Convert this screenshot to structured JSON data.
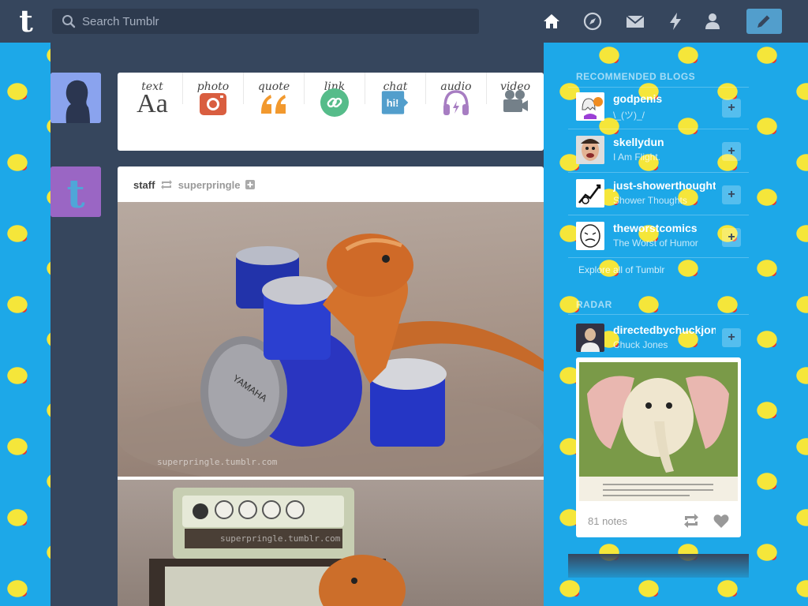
{
  "topbar": {
    "logo": "t",
    "search_placeholder": "Search Tumblr",
    "icons": [
      "home-icon",
      "explore-icon",
      "inbox-icon",
      "activity-icon",
      "account-icon"
    ],
    "compose_icon": "pencil-icon"
  },
  "post_types": [
    {
      "label": "text",
      "icon": "Aa"
    },
    {
      "label": "photo",
      "icon": "camera-icon"
    },
    {
      "label": "quote",
      "icon": "quote-icon"
    },
    {
      "label": "link",
      "icon": "link-icon"
    },
    {
      "label": "chat",
      "icon": "hi!"
    },
    {
      "label": "audio",
      "icon": "headphones-icon"
    },
    {
      "label": "video",
      "icon": "video-camera-icon"
    }
  ],
  "post": {
    "author": "staff",
    "reblogged_from": "superpringle",
    "watermark1": "superpringle.tumblr.com",
    "watermark2": "superpringle.tumblr.com"
  },
  "sidebar": {
    "recommended_title": "RECOMMENDED BLOGS",
    "blogs": [
      {
        "name": "godpenis",
        "desc": "\\_(ツ)_/"
      },
      {
        "name": "skellydun",
        "desc": "I Am Flight."
      },
      {
        "name": "just-showerthoughts",
        "desc": "Shower Thoughts"
      },
      {
        "name": "theworstcomics",
        "desc": "The Worst of Humor"
      }
    ],
    "explore_link": "Explore all of Tumblr",
    "radar_title": "RADAR",
    "radar_blog": {
      "name": "directedbychuckjones",
      "desc": "Chuck Jones"
    },
    "radar_notes": "81 notes"
  },
  "colors": {
    "navy": "#36465d",
    "background": "#1da8e8",
    "accent": "#529ecc"
  }
}
